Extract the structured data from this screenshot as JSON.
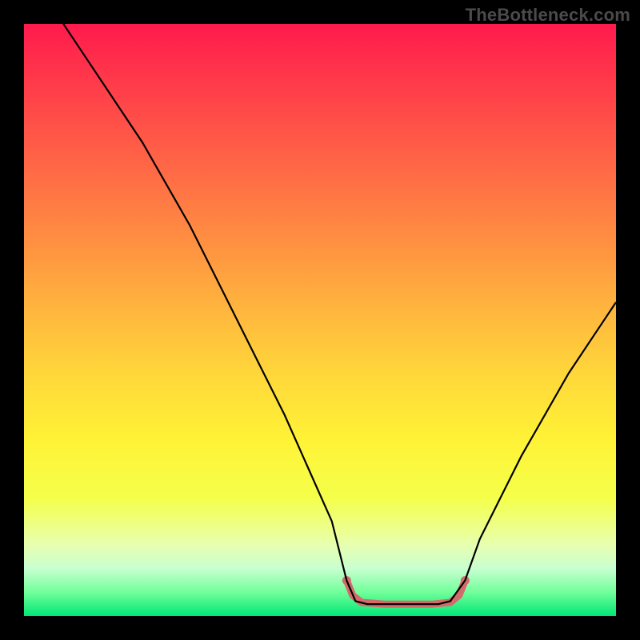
{
  "watermark": "TheBottleneck.com",
  "chart_data": {
    "type": "line",
    "title": "",
    "xlabel": "",
    "ylabel": "",
    "xlim": [
      0,
      100
    ],
    "ylim": [
      0,
      100
    ],
    "series": [
      {
        "name": "bottleneck-curve",
        "x": [
          0,
          4,
          8,
          12,
          16,
          20,
          24,
          28,
          32,
          36,
          40,
          44,
          48,
          52,
          54.5,
          56,
          58,
          60,
          62,
          64,
          66,
          68,
          70,
          72,
          74.5,
          77,
          80,
          84,
          88,
          92,
          96,
          100
        ],
        "values": [
          110,
          104,
          98,
          92,
          86,
          80,
          73,
          66,
          58,
          50,
          42,
          34,
          25,
          16,
          6,
          2.5,
          2,
          2,
          2,
          2,
          2,
          2,
          2,
          2.5,
          6,
          13,
          19,
          27,
          34,
          41,
          47,
          53
        ],
        "color": "#000000"
      },
      {
        "name": "highlight-band",
        "x": [
          54.5,
          55.5,
          57,
          61,
          65,
          69,
          72,
          73.5,
          74.5
        ],
        "values": [
          6,
          3.5,
          2.3,
          2,
          2,
          2,
          2.3,
          3.5,
          6
        ],
        "color": "#d46a6a"
      }
    ],
    "annotations": [],
    "notes": "V-shaped black curve on a vertical red→yellow→green gradient background; a small coral-colored dotted/thick band highlights the flat bottom of the valley between roughly x=55 and x=75."
  }
}
